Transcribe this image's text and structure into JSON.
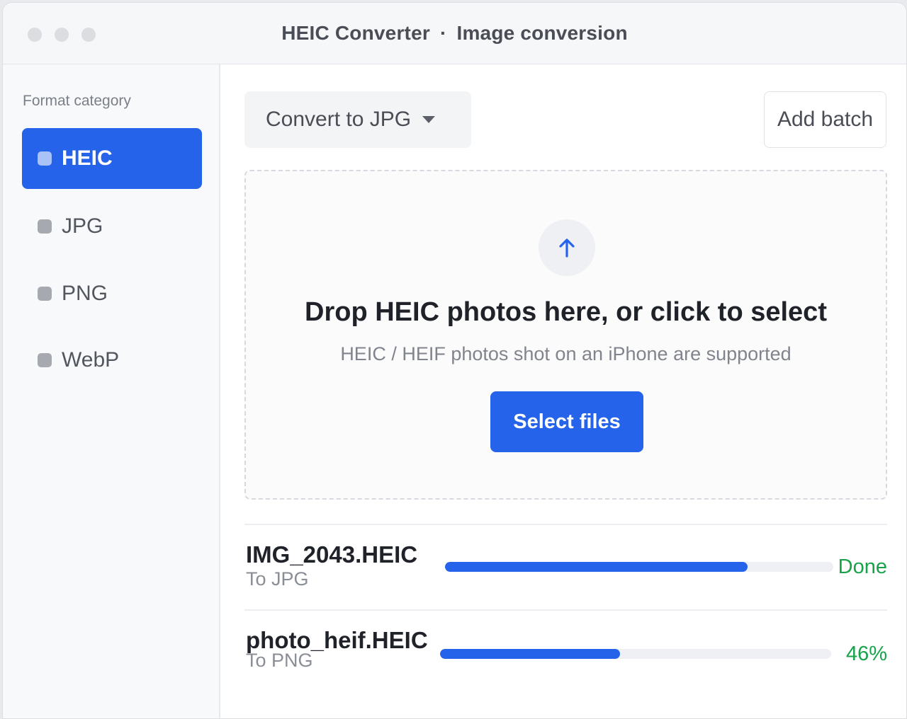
{
  "window": {
    "app_name": "HEIC Converter",
    "separator": "·",
    "subtitle": "Image conversion"
  },
  "sidebar": {
    "heading": "Format category",
    "items": [
      {
        "label": "HEIC",
        "active": true
      },
      {
        "label": "JPG",
        "active": false
      },
      {
        "label": "PNG",
        "active": false
      },
      {
        "label": "WebP",
        "active": false
      }
    ]
  },
  "toolbar": {
    "format_select_value": "Convert to JPG",
    "add_batch_label": "Add batch"
  },
  "dropzone": {
    "title": "Drop HEIC photos here, or click to select",
    "subtitle": "HEIC / HEIF photos shot on an iPhone are supported",
    "button_label": "Select files",
    "icon": "upload-arrow-icon"
  },
  "files": [
    {
      "name": "IMG_2043.HEIC",
      "target": "To JPG",
      "progress": 0.78,
      "status": "Done"
    },
    {
      "name": "photo_heif.HEIC",
      "target": "To PNG",
      "progress": 0.46,
      "status": "46%"
    }
  ],
  "colors": {
    "accent": "#2563eb",
    "success": "#16a34a",
    "track": "#eef0f4"
  }
}
